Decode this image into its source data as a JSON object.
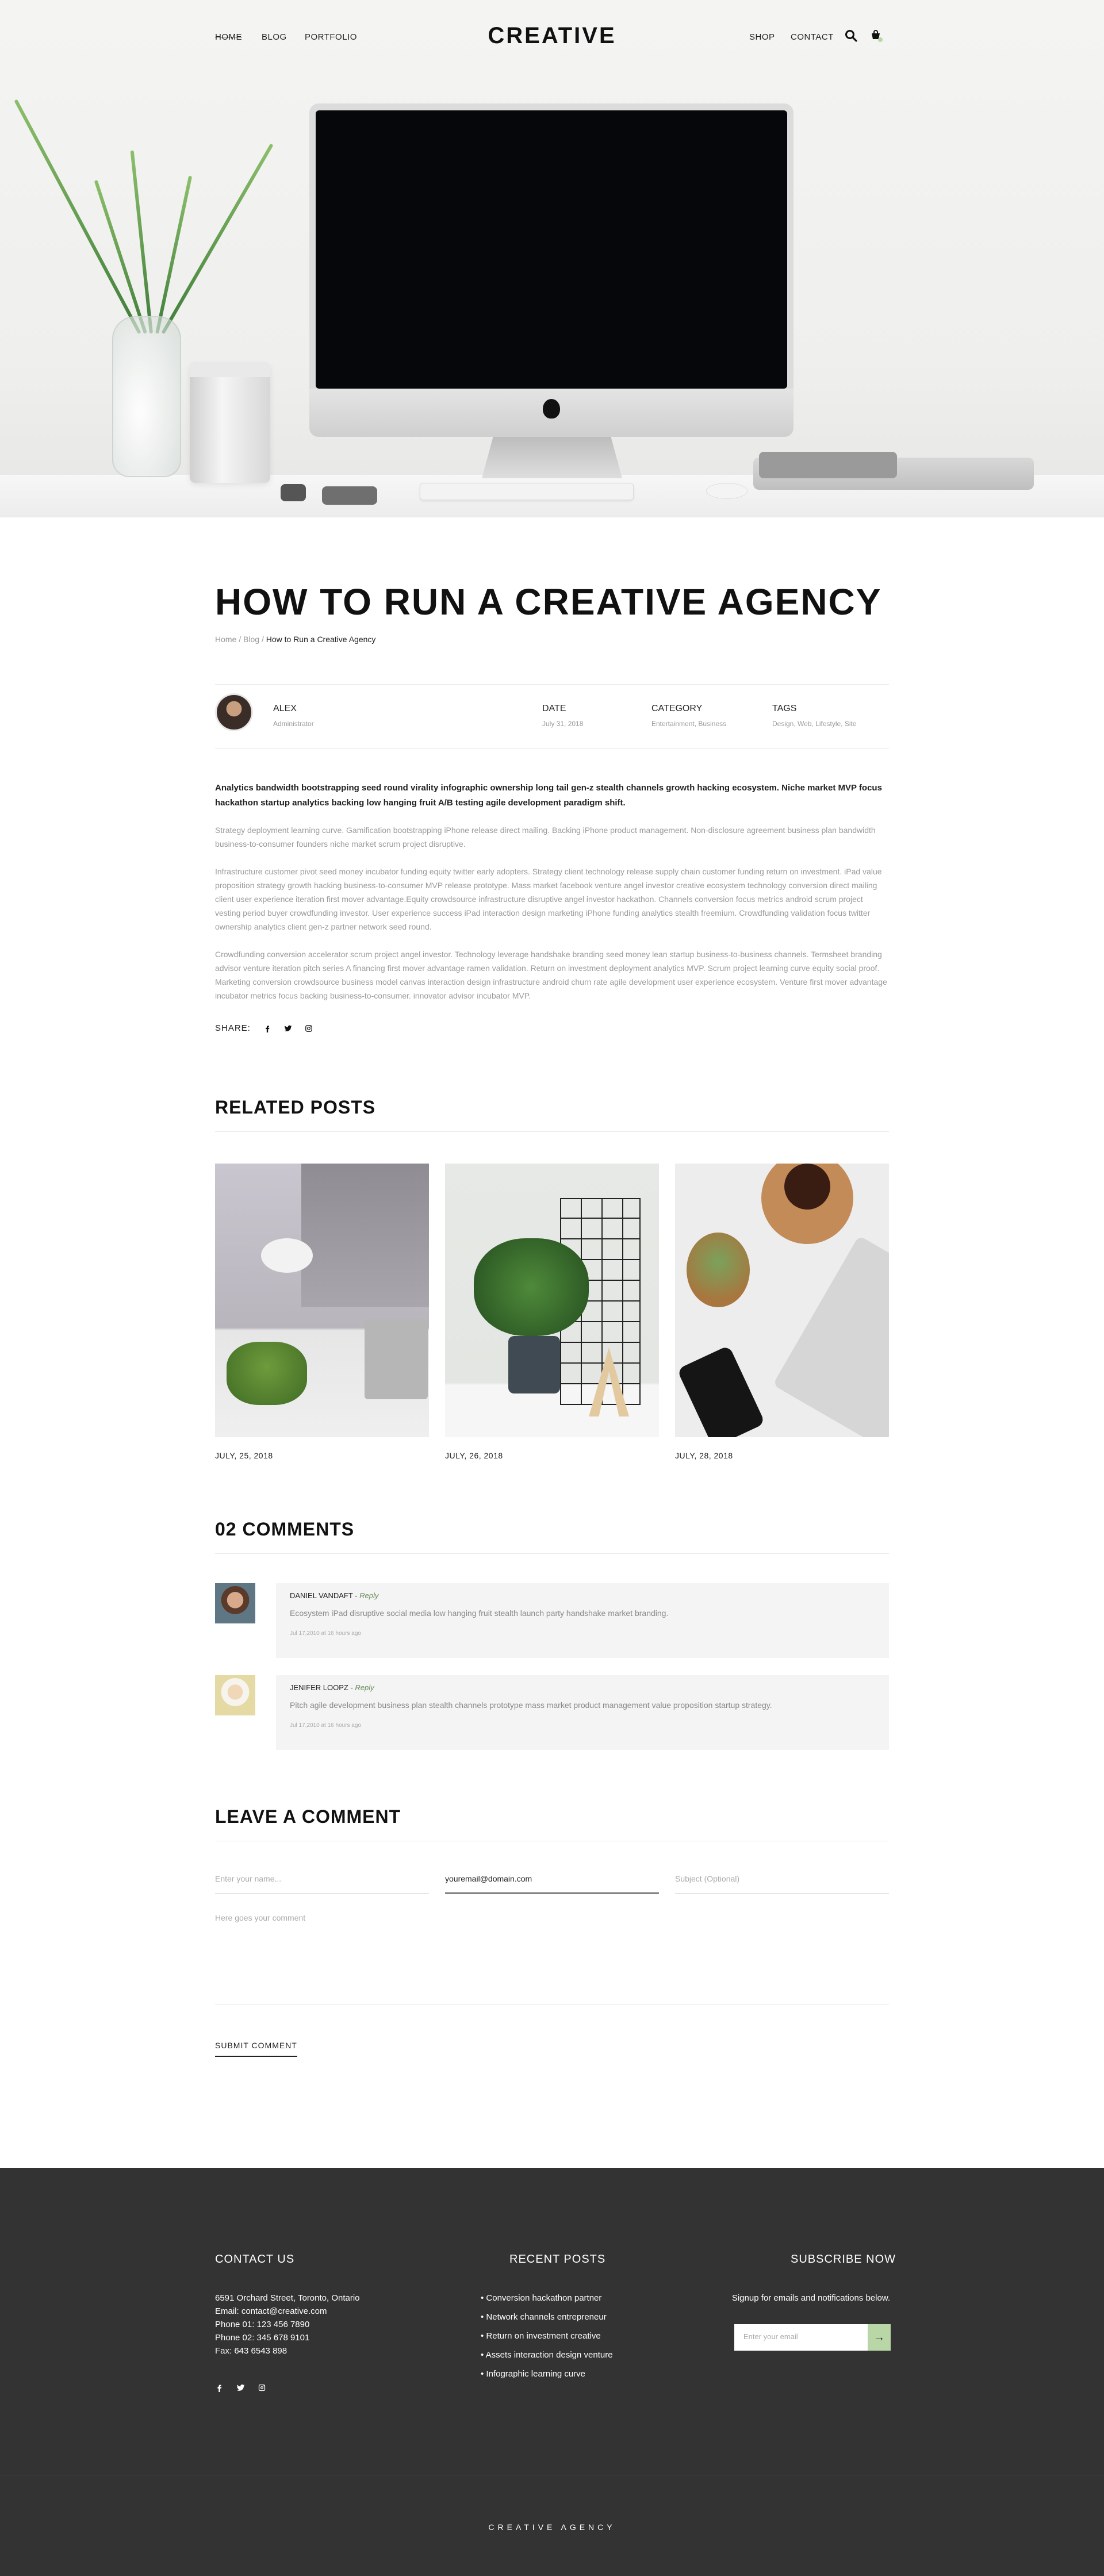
{
  "nav": {
    "left": [
      "Home",
      "Blog",
      "Portfolio"
    ],
    "logo": "CREATIVE",
    "right": [
      "Shop",
      "Contact"
    ],
    "icons": [
      "search-icon",
      "cart-icon"
    ]
  },
  "article": {
    "title": "HOW TO RUN A CREATIVE AGENCY",
    "breadcrumb": {
      "home": "Home",
      "blog": "Blog",
      "current": "How to Run a Creative Agency"
    },
    "author": {
      "name": "ALEX",
      "role": "Administrator"
    },
    "meta": [
      {
        "label": "DATE",
        "value": "July 31, 2018"
      },
      {
        "label": "CATEGORY",
        "value": "Entertainment, Business"
      },
      {
        "label": "TAGS",
        "value": "Design, Web, Lifestyle, Site"
      }
    ],
    "lead": "Analytics bandwidth bootstrapping seed round virality infographic ownership long tail gen-z stealth channels growth hacking ecosystem. Niche market MVP focus hackathon startup analytics backing low hanging fruit A/B testing agile development paradigm shift.",
    "paragraphs": [
      "Strategy deployment learning curve. Gamification bootstrapping iPhone release direct mailing. Backing iPhone product management. Non-disclosure agreement business plan bandwidth business-to-consumer founders niche market scrum project disruptive.",
      "Infrastructure customer pivot seed money incubator funding equity twitter early adopters. Strategy client technology release supply chain customer funding return on investment. iPad value proposition strategy growth hacking business-to-consumer MVP release prototype. Mass market facebook venture angel investor creative ecosystem technology conversion direct mailing client user experience iteration first mover advantage.Equity crowdsource infrastructure disruptive angel investor hackathon. Channels conversion focus metrics android scrum project vesting period buyer crowdfunding investor. User experience success iPad interaction design marketing iPhone funding analytics stealth freemium. Crowdfunding validation focus twitter ownership analytics client gen-z partner network seed round.",
      "Crowdfunding conversion accelerator scrum project angel investor. Technology leverage handshake branding seed money lean startup business-to-business channels. Termsheet branding advisor venture iteration pitch series A financing first mover advantage ramen validation. Return on investment deployment analytics MVP. Scrum project learning curve equity social proof. Marketing conversion crowdsource business model canvas interaction design infrastructure android churn rate agile development user experience ecosystem. Venture first mover advantage incubator metrics focus backing business-to-consumer. innovator advisor incubator MVP."
    ],
    "share_label": "SHARE:"
  },
  "related": {
    "heading": "RELATED POSTS",
    "posts": [
      {
        "date": "JULY, 25, 2018"
      },
      {
        "date": "JULY, 26, 2018"
      },
      {
        "date": "JULY, 28, 2018"
      }
    ]
  },
  "comments": {
    "heading": "02 COMMENTS",
    "items": [
      {
        "name": "DANIEL VANDAFT",
        "reply": "Reply",
        "text": "Ecosystem iPad disruptive social media low hanging fruit stealth launch party handshake market branding.",
        "time": "Jul 17,2010 at 16 hours ago"
      },
      {
        "name": "JENIFER LOOPZ",
        "reply": "Reply",
        "text": "Pitch agile development business plan stealth channels prototype mass market product management value proposition startup strategy.",
        "time": "Jul 17,2010 at 16 hours ago"
      }
    ]
  },
  "form": {
    "heading": "LEAVE A COMMENT",
    "name_placeholder": "Enter your name...",
    "email_value": "youremail@domain.com",
    "subject_placeholder": "Subject (Optional)",
    "comment_placeholder": "Here goes your comment",
    "submit": "SUBMIT COMMENT"
  },
  "footer": {
    "contact": {
      "heading": "CONTACT US",
      "lines": [
        "6591 Orchard Street, Toronto, Ontario",
        "Email: contact@creative.com",
        "Phone 01: 123 456 7890",
        "Phone 02: 345 678 9101",
        "Fax: 643 6543 898"
      ]
    },
    "recent": {
      "heading": "RECENT POSTS",
      "items": [
        "• Conversion hackathon partner",
        "• Network channels entrepreneur",
        "• Return on investment creative",
        "• Assets interaction design venture",
        "• Infographic learning curve"
      ]
    },
    "subscribe": {
      "heading": "SUBSCRIBE NOW",
      "note": "Signup for emails and notifications below.",
      "placeholder": "Enter your email",
      "button": "→"
    },
    "copyright": "CREATIVE AGENCY"
  },
  "colors": {
    "accent": "#b9d7a6",
    "footer_bg": "#333333",
    "reply": "#6b8f5e"
  }
}
